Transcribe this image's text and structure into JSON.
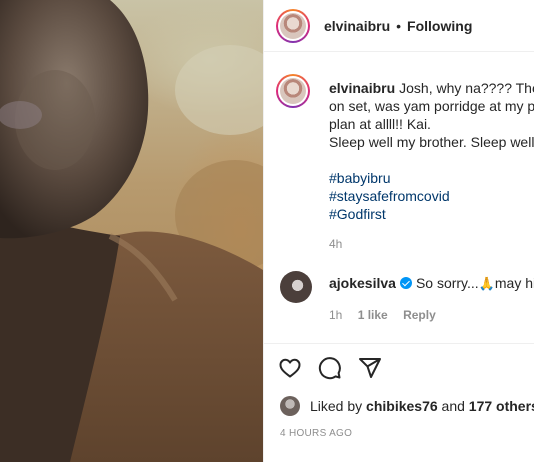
{
  "photo": {
    "alt_subject": "man"
  },
  "header": {
    "username": "elvinaibru",
    "separator": "•",
    "follow_state": "Following"
  },
  "caption": {
    "username": "elvinaibru",
    "lines": [
      "Josh, why na???? The pl",
      "on set, was yam porridge at my pla",
      "plan at allll!! Kai.",
      "Sleep well my brother. Sleep well.."
    ],
    "hashtags": [
      "#babyibru",
      "#staysafefromcovid",
      "#Godfirst"
    ],
    "time": "4h"
  },
  "comment": {
    "username": "ajokesilva",
    "text": "So sorry...",
    "emoji": "🙏",
    "text_after": "may his",
    "time": "1h",
    "likes": "1 like",
    "reply": "Reply"
  },
  "actions": {
    "icons": [
      "heart-icon",
      "comment-icon",
      "share-icon"
    ]
  },
  "likes": {
    "prefix": "Liked by",
    "user": "chibikes76",
    "middle": "and",
    "others": "177 others"
  },
  "post_time": "4 HOURS AGO",
  "colors": {
    "text": "#262626",
    "secondary": "#8e8e8e",
    "hashtag": "#00376b",
    "verified": "#0095f6",
    "border": "#efefef"
  }
}
